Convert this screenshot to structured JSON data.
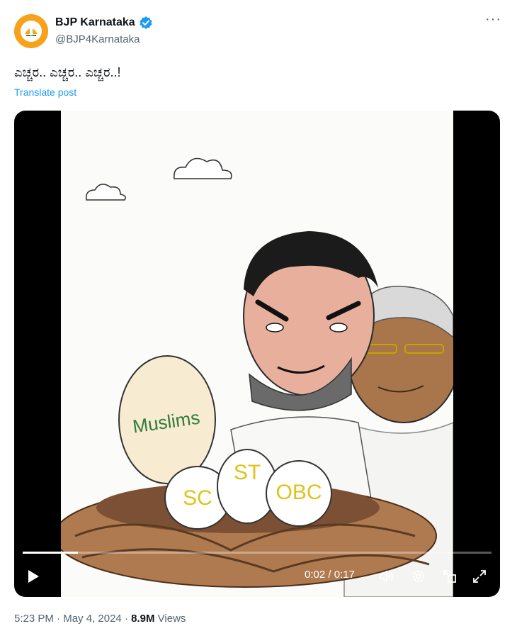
{
  "account": {
    "name": "BJP Karnataka",
    "handle": "@BJP4Karnataka",
    "verified_color": "#1d9bf0",
    "avatar_color": "#f7a21b"
  },
  "post": {
    "text": "ಎಚ್ಚರ.. ಎಚ್ಚರ.. ಎಚ್ಚರ..!",
    "translate_label": "Translate post"
  },
  "video": {
    "eggs": {
      "big": "Muslims",
      "left": "SC",
      "middle": "ST",
      "right": "OBC"
    },
    "time_display": "0:02 / 0:17",
    "progress_fraction": 0.118
  },
  "footer": {
    "time": "5:23 PM",
    "date": "May 4, 2024",
    "views_count": "8.9M",
    "views_label": "Views"
  },
  "icons": [
    "verified-badge-icon",
    "more-icon",
    "play-icon",
    "volume-icon",
    "settings-icon",
    "pip-icon",
    "fullscreen-icon"
  ]
}
